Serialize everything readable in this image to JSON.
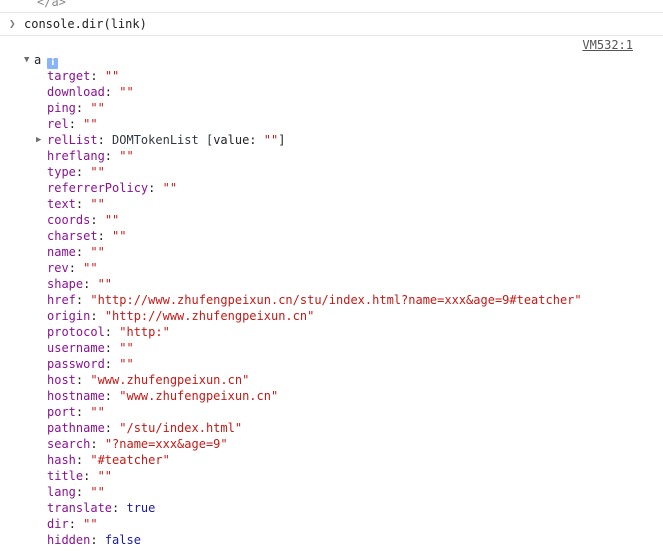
{
  "top_tag": "</a>",
  "command": {
    "prompt_icon": "chevron-right-icon",
    "text": "console.dir(link)"
  },
  "source_link": "VM532:1",
  "object": {
    "name": "a",
    "info_badge": "i",
    "properties": [
      {
        "key": "target",
        "type": "str",
        "value": "\"\""
      },
      {
        "key": "download",
        "type": "str",
        "value": "\"\""
      },
      {
        "key": "ping",
        "type": "str",
        "value": "\"\""
      },
      {
        "key": "rel",
        "type": "str",
        "value": "\"\""
      },
      {
        "key": "relList",
        "type": "object",
        "value": "DOMTokenList [value: \"\"]",
        "class_name": "DOMTokenList",
        "inner_key": "value",
        "inner_value": "\"\""
      },
      {
        "key": "hreflang",
        "type": "str",
        "value": "\"\""
      },
      {
        "key": "type",
        "type": "str",
        "value": "\"\""
      },
      {
        "key": "referrerPolicy",
        "type": "str",
        "value": "\"\""
      },
      {
        "key": "text",
        "type": "str",
        "value": "\"\""
      },
      {
        "key": "coords",
        "type": "str",
        "value": "\"\""
      },
      {
        "key": "charset",
        "type": "str",
        "value": "\"\""
      },
      {
        "key": "name",
        "type": "str",
        "value": "\"\""
      },
      {
        "key": "rev",
        "type": "str",
        "value": "\"\""
      },
      {
        "key": "shape",
        "type": "str",
        "value": "\"\""
      },
      {
        "key": "href",
        "type": "str",
        "value": "\"http://www.zhufengpeixun.cn/stu/index.html?name=xxx&age=9#teatcher\""
      },
      {
        "key": "origin",
        "type": "str",
        "value": "\"http://www.zhufengpeixun.cn\""
      },
      {
        "key": "protocol",
        "type": "str",
        "value": "\"http:\""
      },
      {
        "key": "username",
        "type": "str",
        "value": "\"\""
      },
      {
        "key": "password",
        "type": "str",
        "value": "\"\""
      },
      {
        "key": "host",
        "type": "str",
        "value": "\"www.zhufengpeixun.cn\""
      },
      {
        "key": "hostname",
        "type": "str",
        "value": "\"www.zhufengpeixun.cn\""
      },
      {
        "key": "port",
        "type": "str",
        "value": "\"\""
      },
      {
        "key": "pathname",
        "type": "str",
        "value": "\"/stu/index.html\""
      },
      {
        "key": "search",
        "type": "str",
        "value": "\"?name=xxx&age=9\""
      },
      {
        "key": "hash",
        "type": "str",
        "value": "\"#teatcher\""
      },
      {
        "key": "title",
        "type": "str",
        "value": "\"\""
      },
      {
        "key": "lang",
        "type": "str",
        "value": "\"\""
      },
      {
        "key": "translate",
        "type": "bool",
        "value": "true"
      },
      {
        "key": "dir",
        "type": "str",
        "value": "\"\""
      },
      {
        "key": "hidden",
        "type": "bool",
        "value": "false"
      }
    ]
  },
  "colors": {
    "key": "#881391",
    "string": "#c41a16",
    "boolean": "#1a1aa6",
    "info_badge": "#8ab4f8"
  }
}
